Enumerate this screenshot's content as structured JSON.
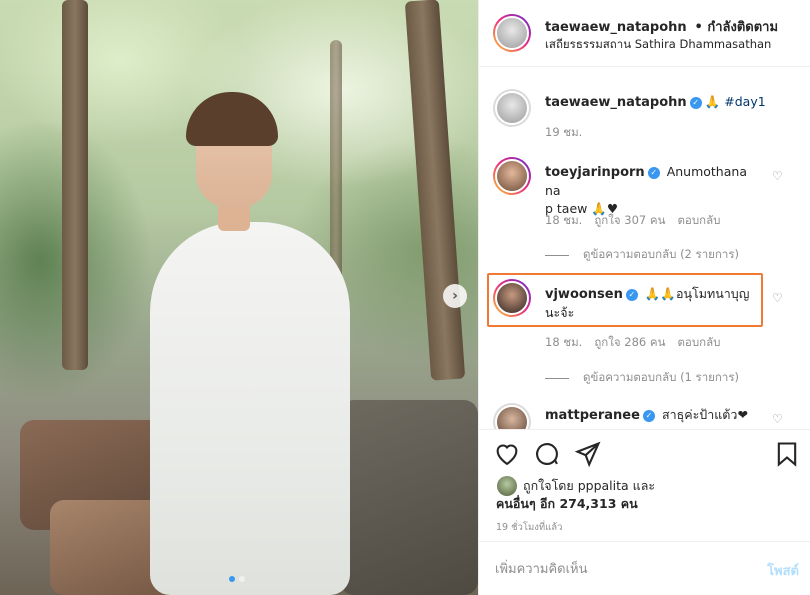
{
  "post": {
    "author": "taewaew_natapohn",
    "follow_status": "• กำลังติดตาม",
    "location": "เสถียรธรรมสถาน Sathira Dhammasathan",
    "caption_emoji": "🙏",
    "caption_tag": "#day1",
    "caption_time": "19 ชม."
  },
  "comments": [
    {
      "username": "toeyjarinporn",
      "text_line1": "Anumothana na",
      "text_line2": "p taew 🙏♥",
      "time": "18 ชม.",
      "likes": "ถูกใจ 307 คน",
      "reply": "ตอบกลับ",
      "view_replies": "ดูข้อความตอบกลับ (2 รายการ)"
    },
    {
      "username": "vjwoonsen",
      "text_line1": "🙏🙏อนุโมทนาบุญ",
      "text_line2": "นะจ้ะ",
      "time": "18 ชม.",
      "likes": "ถูกใจ 286 คน",
      "reply": "ตอบกลับ",
      "view_replies": "ดูข้อความตอบกลับ (1 รายการ)"
    },
    {
      "username": "mattperanee",
      "text_line1": "สาธุค่ะป้าแต้ว❤"
    }
  ],
  "likes": {
    "line1": "ถูกใจโดย pppalita และ",
    "line2": "คนอื่นๆ อีก 274,313 คน",
    "time_ago": "19 ชั่วโมงที่แล้ว"
  },
  "add_comment": {
    "placeholder": "เพิ่มความคิดเห็น",
    "post_label": "โพสต์"
  },
  "carousel": {
    "slides": 2,
    "active_index": 0
  },
  "icons": {
    "verified": "verified-badge-icon",
    "like": "heart-icon",
    "comment": "comment-icon",
    "share": "paper-plane-icon",
    "save": "bookmark-icon",
    "next": "chevron-right-icon"
  },
  "colors": {
    "verified": "#3897f0",
    "highlight": "#f07a34",
    "post_btn": "#b2dffc"
  }
}
